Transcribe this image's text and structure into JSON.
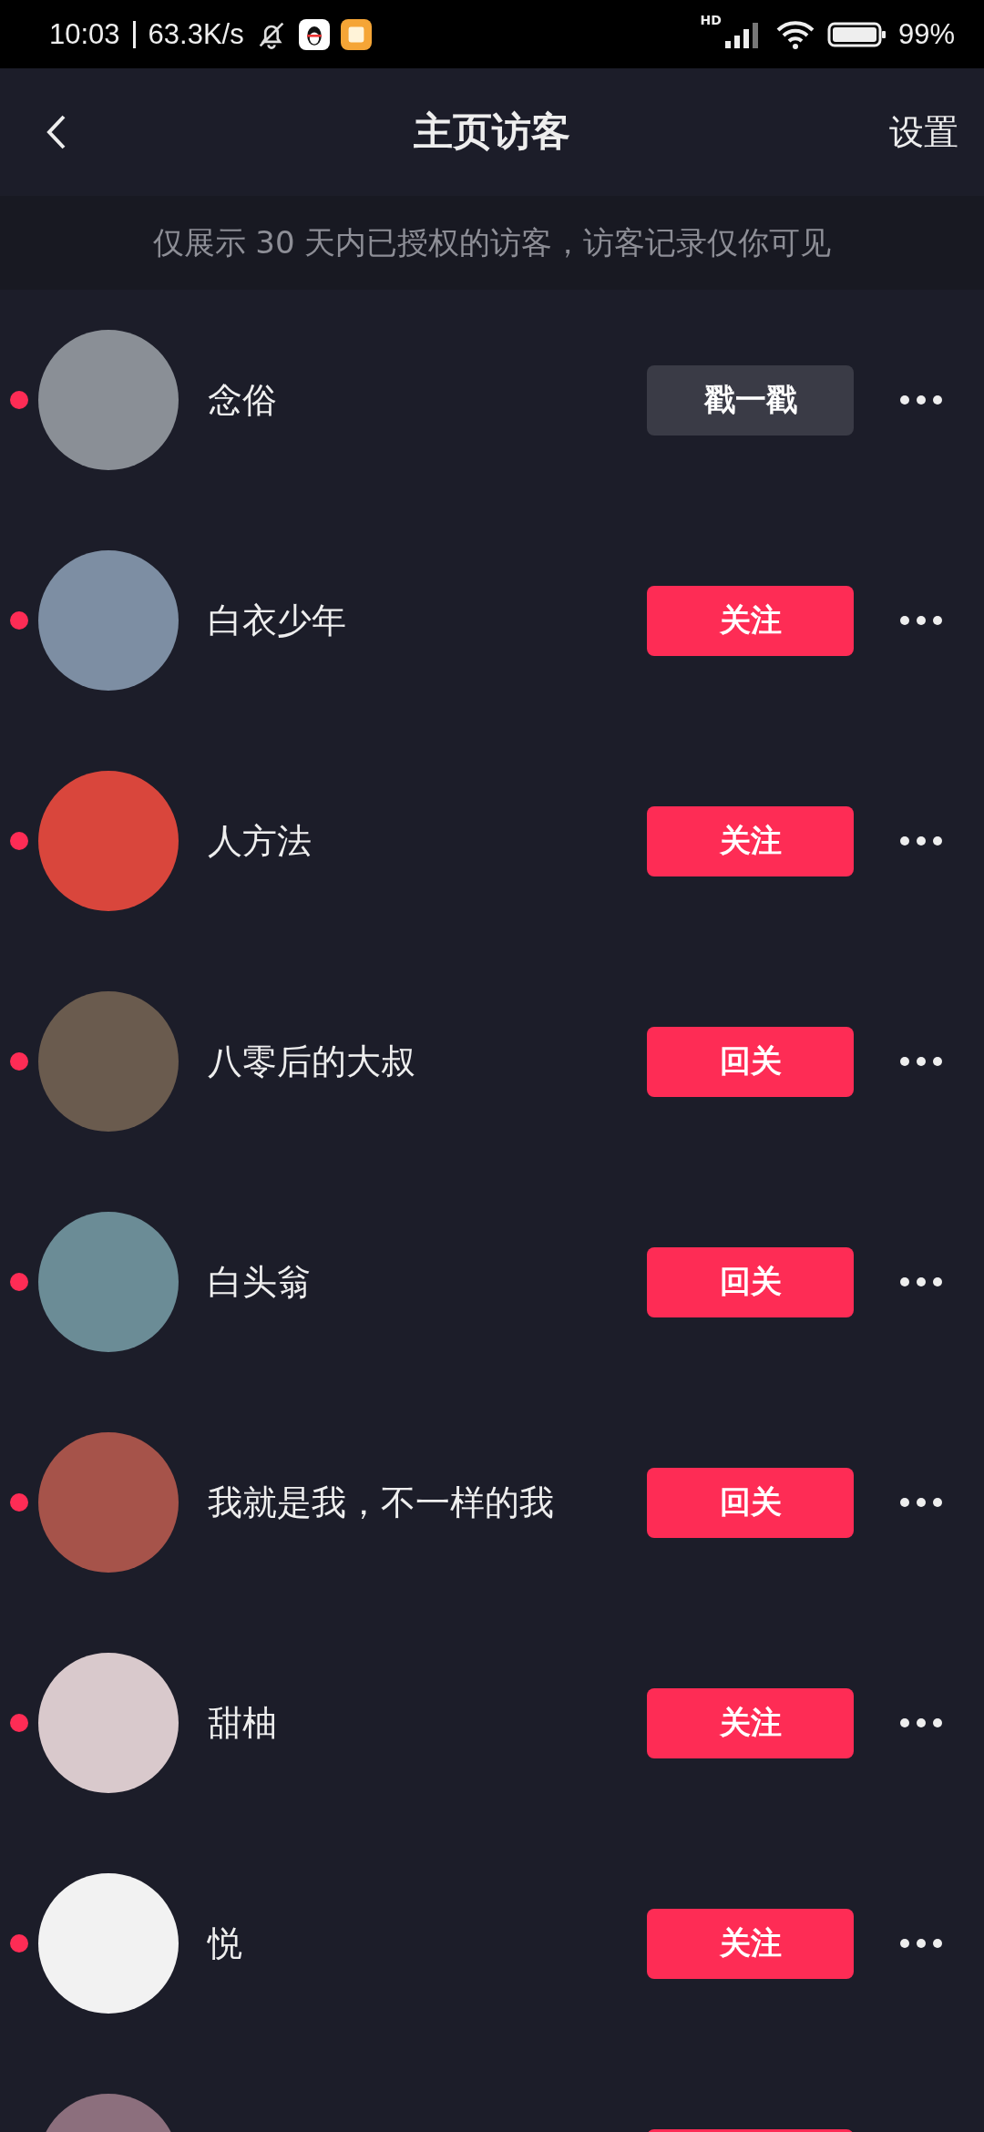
{
  "status_bar": {
    "time": "10:03",
    "speed": "63.3K/s",
    "network_label": "HD",
    "battery": "99%"
  },
  "header": {
    "title": "主页访客",
    "settings": "设置"
  },
  "notice": "仅展示 30 天内已授权的访客，访客记录仅你可见",
  "visitors": [
    {
      "name": "念俗",
      "unread": true,
      "button": {
        "label": "戳一戳",
        "kind": "poke"
      }
    },
    {
      "name": "白衣少年",
      "unread": true,
      "button": {
        "label": "关注",
        "kind": "follow"
      }
    },
    {
      "name": "人方法",
      "unread": true,
      "button": {
        "label": "关注",
        "kind": "follow"
      }
    },
    {
      "name": "八零后的大叔",
      "unread": true,
      "button": {
        "label": "回关",
        "kind": "follow"
      }
    },
    {
      "name": "白头翁",
      "unread": true,
      "button": {
        "label": "回关",
        "kind": "follow"
      }
    },
    {
      "name": "我就是我，不一样的我",
      "unread": true,
      "button": {
        "label": "回关",
        "kind": "follow"
      }
    },
    {
      "name": "甜柚",
      "unread": true,
      "button": {
        "label": "关注",
        "kind": "follow"
      }
    },
    {
      "name": "悦",
      "unread": true,
      "button": {
        "label": "关注",
        "kind": "follow"
      }
    },
    {
      "button": {
        "kind": "follow"
      }
    }
  ]
}
